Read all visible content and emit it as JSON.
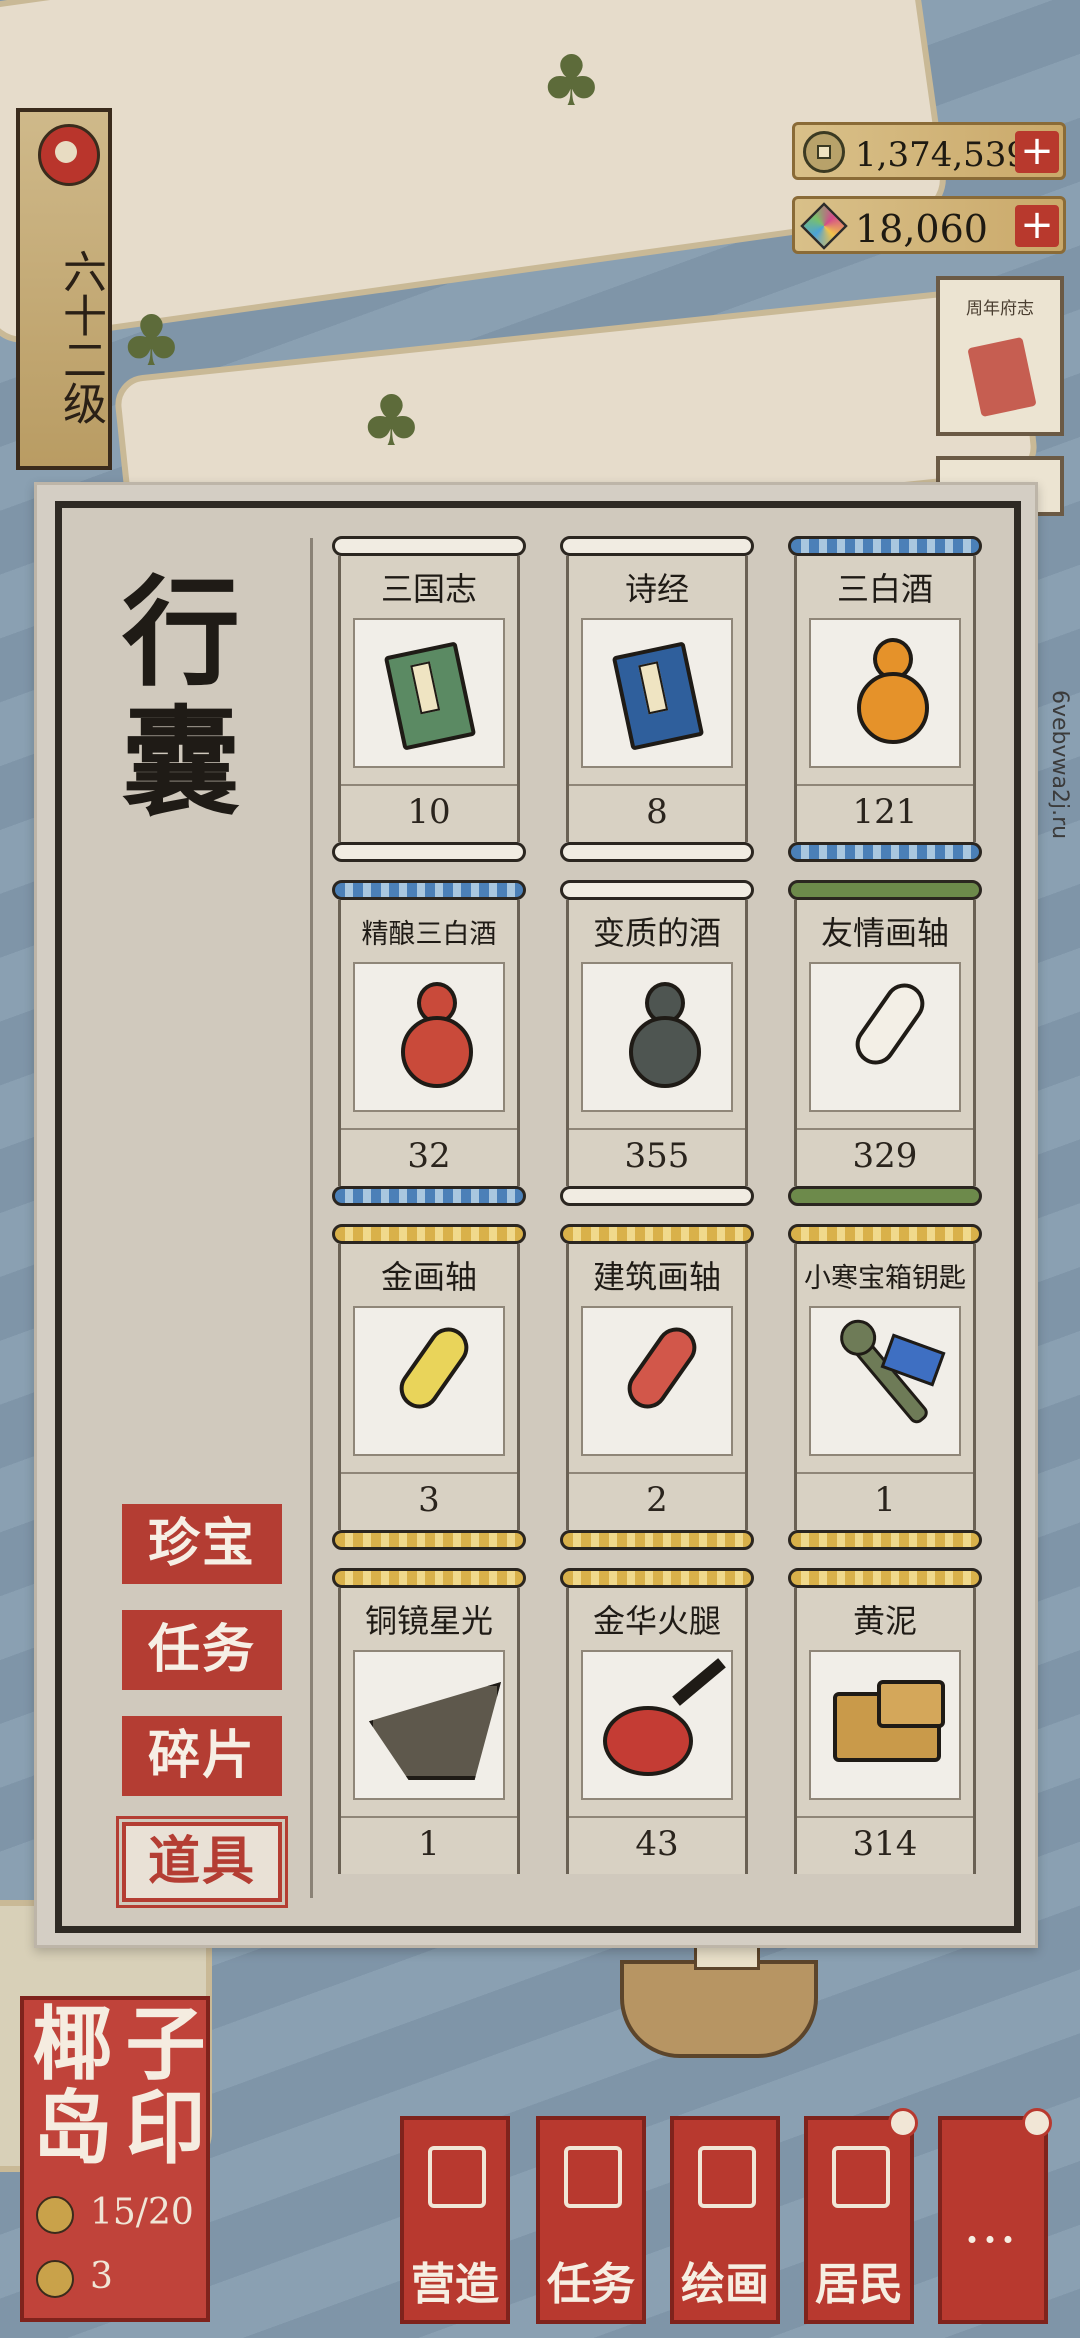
{
  "player": {
    "level": "六十二级"
  },
  "currency": {
    "coins": "1,374,539",
    "gems": "18,060"
  },
  "side": {
    "notice_title": "周年府志",
    "watermark": "6vebvwa2j.ru"
  },
  "panel": {
    "title": "行囊",
    "tabs": [
      {
        "label": "珍宝",
        "active": false
      },
      {
        "label": "任务",
        "active": false
      },
      {
        "label": "碎片",
        "active": false
      },
      {
        "label": "道具",
        "active": true
      }
    ],
    "items": [
      {
        "name": "三国志",
        "count": "10",
        "icon": "green-book-icon"
      },
      {
        "name": "诗经",
        "count": "8",
        "icon": "blue-book-icon"
      },
      {
        "name": "三白酒",
        "count": "121",
        "icon": "orange-gourd-icon"
      },
      {
        "name": "精酿三白酒",
        "count": "32",
        "icon": "red-gourd-icon"
      },
      {
        "name": "变质的酒",
        "count": "355",
        "icon": "dark-gourd-icon"
      },
      {
        "name": "友情画轴",
        "count": "329",
        "icon": "white-scroll-icon"
      },
      {
        "name": "金画轴",
        "count": "3",
        "icon": "yellow-scroll-icon"
      },
      {
        "name": "建筑画轴",
        "count": "2",
        "icon": "red-scroll-icon"
      },
      {
        "name": "小寒宝箱钥匙",
        "count": "1",
        "icon": "key-icon"
      },
      {
        "name": "铜镜星光",
        "count": "1",
        "icon": "mirror-icon"
      },
      {
        "name": "金华火腿",
        "count": "43",
        "icon": "ham-icon"
      },
      {
        "name": "黄泥",
        "count": "314",
        "icon": "clay-icon"
      }
    ]
  },
  "island": {
    "name_chars": [
      "椰",
      "子",
      "岛",
      "印"
    ],
    "residents": "15/20",
    "coins": "3"
  },
  "menu": [
    {
      "label": "营造",
      "icon": "building-icon"
    },
    {
      "label": "任务",
      "icon": "task-book-icon"
    },
    {
      "label": "绘画",
      "icon": "scroll-paint-icon"
    },
    {
      "label": "居民",
      "icon": "resident-icon"
    },
    {
      "label": "…",
      "icon": "more-icon"
    }
  ]
}
